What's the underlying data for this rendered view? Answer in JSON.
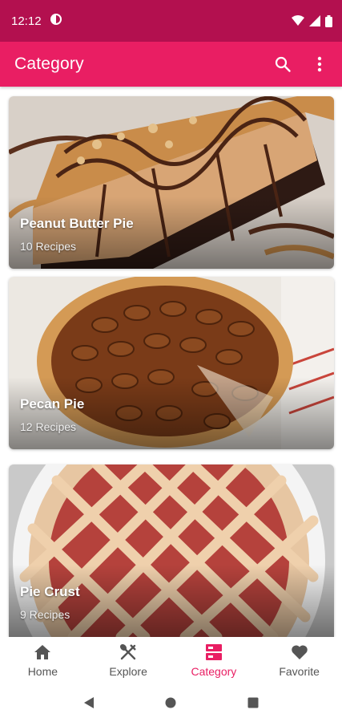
{
  "status_bar": {
    "time": "12:12"
  },
  "app_bar": {
    "title": "Category",
    "search_icon": "search-icon",
    "more_icon": "more-vert-icon"
  },
  "categories": [
    {
      "name": "Peanut Butter Pie",
      "count": "10 Recipes",
      "image": "peanut-butter-pie-photo"
    },
    {
      "name": "Pecan Pie",
      "count": "12 Recipes",
      "image": "pecan-pie-photo"
    },
    {
      "name": "Pie Crust",
      "count": "9 Recipes",
      "image": "pie-crust-photo"
    }
  ],
  "bottom_nav": {
    "items": [
      {
        "label": "Home",
        "icon": "home-icon"
      },
      {
        "label": "Explore",
        "icon": "fork-spoon-icon"
      },
      {
        "label": "Category",
        "icon": "category-icon",
        "active": true
      },
      {
        "label": "Favorite",
        "icon": "heart-icon"
      }
    ]
  },
  "colors": {
    "status_bar": "#b3104f",
    "primary": "#e91e63",
    "nav_inactive": "#555555"
  }
}
